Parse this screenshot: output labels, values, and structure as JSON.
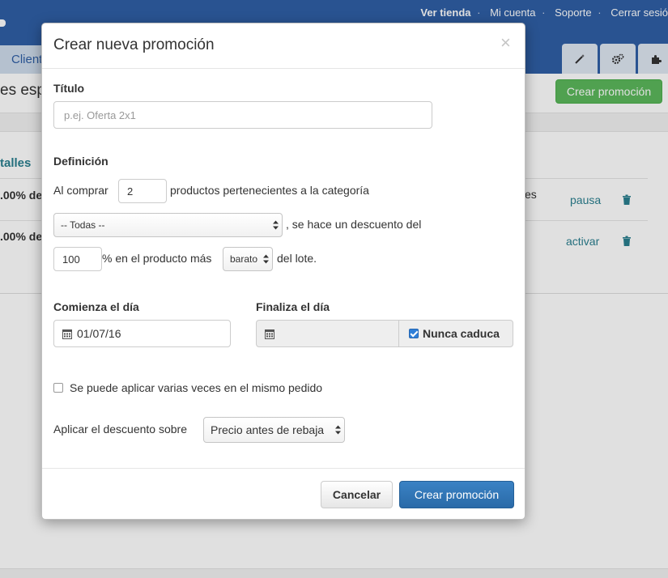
{
  "background": {
    "top_links": [
      "Ver tienda",
      "Mi cuenta",
      "Soporte",
      "Cerrar sesió"
    ],
    "nav_tab_left": "Client",
    "page_title": "es esp",
    "create_button": "Crear promoción",
    "details_link": "talles",
    "rows": [
      {
        "text": ".00% de",
        "tail": "es",
        "action": "pausa"
      },
      {
        "text": ".00% de",
        "tail": "",
        "action": "activar"
      }
    ],
    "icon_tabs": [
      "wand-icon",
      "gears-icon",
      "puzzle-icon"
    ]
  },
  "modal": {
    "title": "Crear nueva promoción",
    "close": "×",
    "titulo_label": "Título",
    "titulo_placeholder": "p.ej. Oferta 2x1",
    "titulo_value": "",
    "definicion_label": "Definición",
    "al_comprar": "Al comprar",
    "quantity_value": "2",
    "productos_text": "productos pertenecientes a la categoría",
    "category_selected": "-- Todas --",
    "descuento_text": ", se hace un descuento del",
    "percent_value": "100",
    "en_producto_text": "% en el producto más",
    "cheapness_selected": "barato",
    "del_lote_text": "del lote.",
    "comienza_label": "Comienza el día",
    "start_date": "01/07/16",
    "finaliza_label": "Finaliza el día",
    "end_date": "",
    "nunca_caduca": "Nunca caduca",
    "nunca_caduca_checked": true,
    "multiple_label": "Se puede aplicar varias veces en el mismo pedido",
    "multiple_checked": false,
    "aplicar_label": "Aplicar el descuento sobre",
    "aplicar_selected": "Precio antes de rebaja",
    "cancel_button": "Cancelar",
    "submit_button": "Crear promoción"
  },
  "colors": {
    "header_blue": "#2f5fa6",
    "green": "#5cb85c",
    "primary": "#2f74b5",
    "link_teal": "#2a7f8f"
  }
}
